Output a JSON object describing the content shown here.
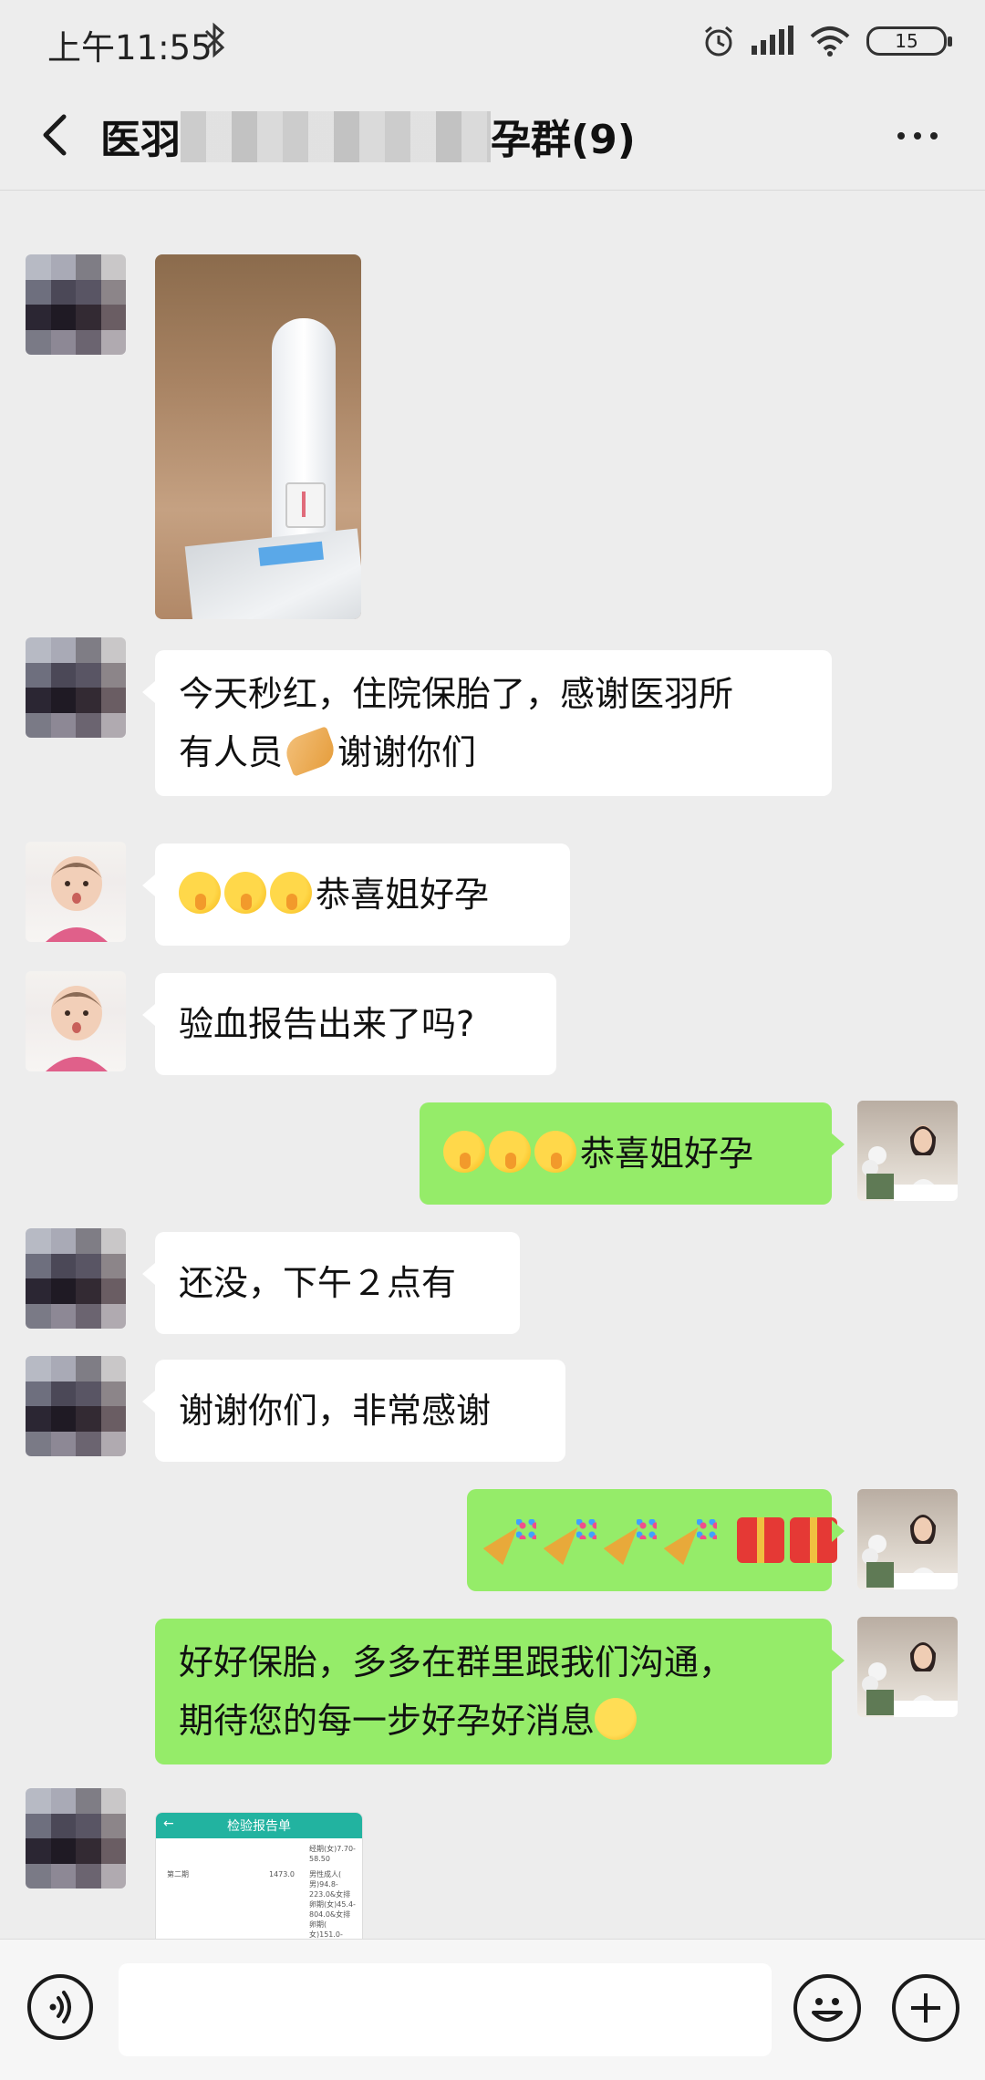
{
  "status_bar": {
    "time": "上午11:55",
    "battery": "15",
    "icons": [
      "bluetooth-icon",
      "alarm-icon",
      "signal-icon",
      "wifi-icon",
      "battery-icon"
    ]
  },
  "header": {
    "title_prefix": "医羽",
    "title_suffix": "孕群(9)",
    "back_icon": "chevron-left-icon",
    "more_icon": "more-dots-icon"
  },
  "messages": [
    {
      "side": "left",
      "type": "image",
      "avatar": "pixelated",
      "image": "pregnancy-test-photo"
    },
    {
      "side": "left",
      "type": "text",
      "avatar": "pixelated",
      "lines": [
        "今天秒红，住院保胎了，感谢医羽所",
        "有人员",
        "谢谢你们"
      ]
    },
    {
      "side": "left",
      "type": "text",
      "avatar": "baby",
      "text": "恭喜姐好孕"
    },
    {
      "side": "left",
      "type": "text",
      "avatar": "baby",
      "text": "验血报告出来了吗?"
    },
    {
      "side": "right",
      "type": "text",
      "avatar": "woman",
      "text": "恭喜姐好孕"
    },
    {
      "side": "left",
      "type": "text",
      "avatar": "pixelated",
      "text": "还没，下午２点有"
    },
    {
      "side": "left",
      "type": "text",
      "avatar": "pixelated",
      "text": "谢谢你们，非常感谢"
    },
    {
      "side": "right",
      "type": "emoji",
      "avatar": "woman",
      "emojis": [
        "party-popper-icon",
        "gift-icon"
      ]
    },
    {
      "side": "right",
      "type": "text",
      "avatar": "woman",
      "lines": [
        "好好保胎，多多在群里跟我们沟通，",
        "期待您的每一步好孕好消息"
      ]
    },
    {
      "side": "left",
      "type": "image",
      "avatar": "pixelated",
      "image": "lab-report-screenshot"
    }
  ],
  "report": {
    "title": "检验报告单",
    "row_label": "第二期",
    "row_value": "1473.0",
    "ref_lines": [
      "经期(女)7.70-",
      "58.50",
      "",
      "男性成人(",
      "男)94.8-",
      "223.0&女排",
      "卵期(女)45.4-",
      "804.0&女排",
      "卵期(",
      "女)151.0-"
    ]
  },
  "input_bar": {
    "placeholder": "",
    "icons": [
      "voice-icon",
      "emoji-face-icon",
      "plus-icon"
    ]
  }
}
